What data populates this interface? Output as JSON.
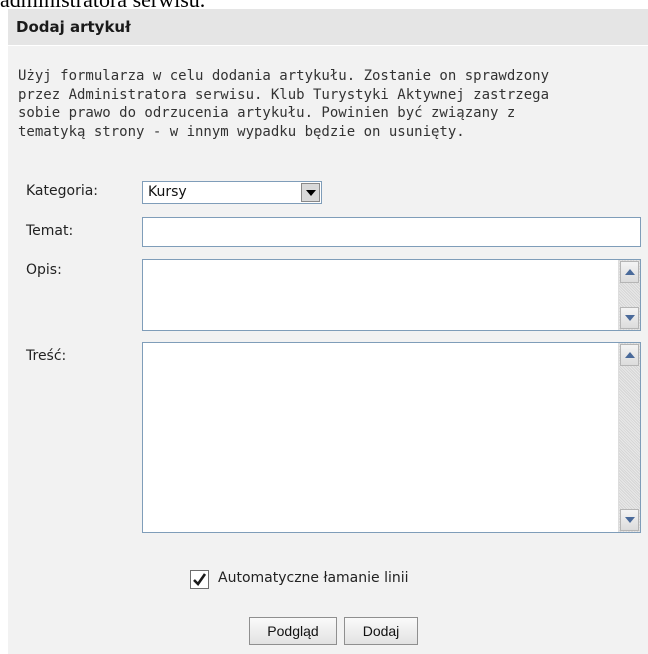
{
  "top_partial_text": "administratora serwisu.",
  "panel": {
    "title": "Dodaj artykuł",
    "intro_lines": [
      "Użyj formularza w celu dodania artykułu. Zostanie on sprawdzony",
      "przez Administratora serwisu. Klub Turystyki Aktywnej zastrzega",
      "sobie prawo do odrzucenia artykułu. Powinien być związany z",
      "tematyką strony - w innym wypadku będzie on usunięty."
    ]
  },
  "form": {
    "kategoria_label": "Kategoria:",
    "kategoria_value": "Kursy",
    "temat_label": "Temat:",
    "temat_value": "",
    "opis_label": "Opis:",
    "opis_value": "",
    "tresc_label": "Treść:",
    "tresc_value": "",
    "auto_wrap_label": "Automatyczne łamanie linii",
    "auto_wrap_checked": true,
    "preview_button": "Podgląd",
    "add_button": "Dodaj"
  }
}
